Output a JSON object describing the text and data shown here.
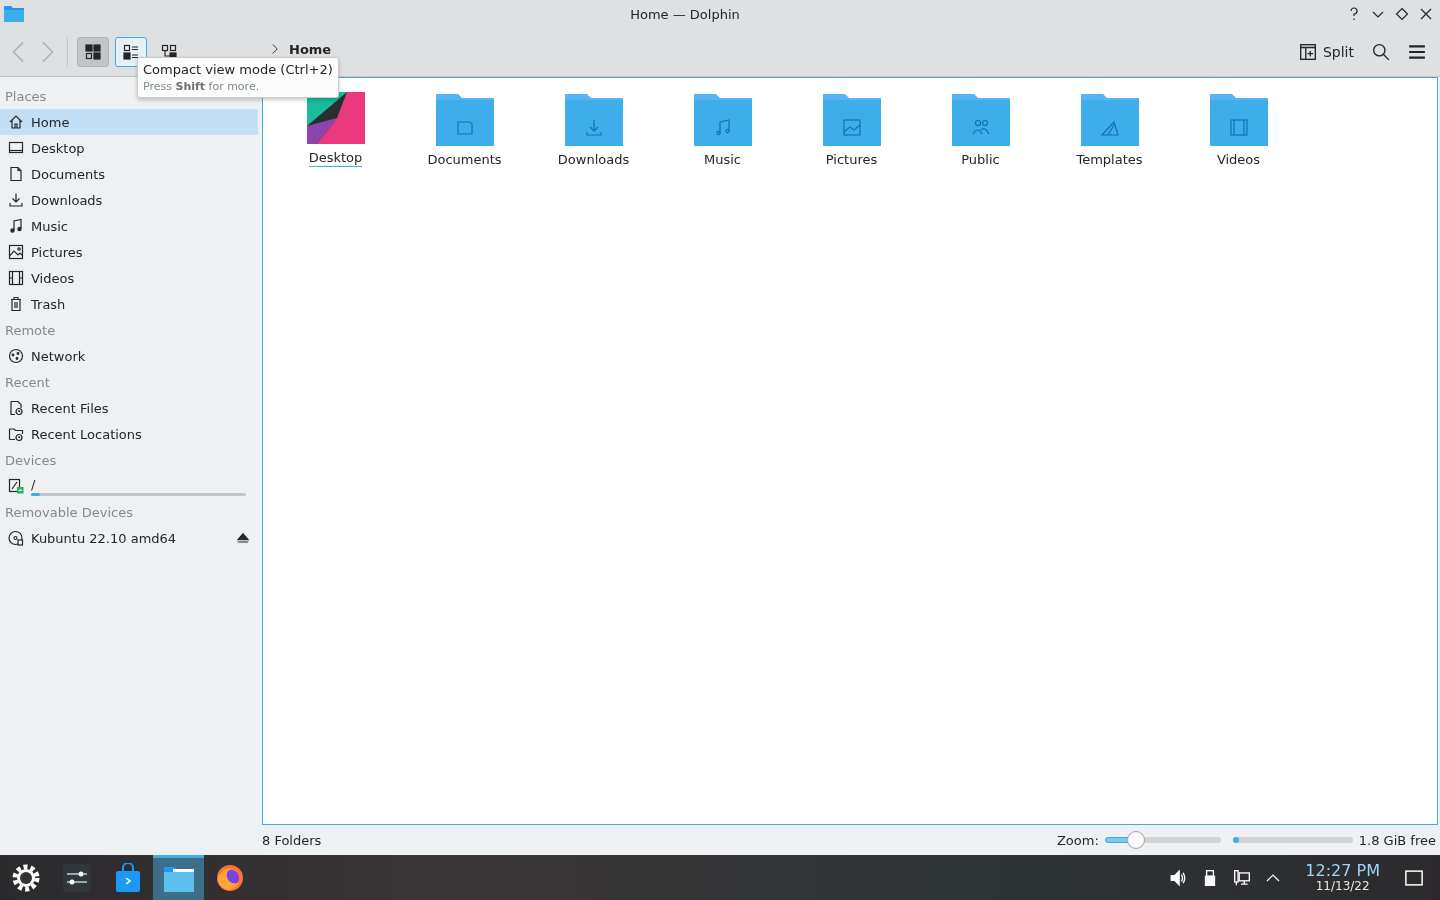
{
  "window": {
    "title": "Home — Dolphin"
  },
  "toolbar": {
    "view_modes": [
      {
        "kind": "icons",
        "selected": true,
        "hovered": false
      },
      {
        "kind": "compact",
        "selected": false,
        "hovered": true
      },
      {
        "kind": "details",
        "selected": false,
        "hovered": false
      }
    ],
    "breadcrumb": "Home",
    "split_label": "Split"
  },
  "tooltip": {
    "title": "Compact view mode (Ctrl+2)",
    "hint": "Press **Shift** for more."
  },
  "sidebar": {
    "sections": [
      {
        "title": "Places",
        "items": [
          {
            "label": "Home",
            "kind": "home",
            "selected": true
          },
          {
            "label": "Desktop",
            "kind": "desktop",
            "selected": false
          },
          {
            "label": "Documents",
            "kind": "document",
            "selected": false
          },
          {
            "label": "Downloads",
            "kind": "download",
            "selected": false
          },
          {
            "label": "Music",
            "kind": "music",
            "selected": false
          },
          {
            "label": "Pictures",
            "kind": "picture",
            "selected": false
          },
          {
            "label": "Videos",
            "kind": "video",
            "selected": false
          },
          {
            "label": "Trash",
            "kind": "trash",
            "selected": false
          }
        ]
      },
      {
        "title": "Remote",
        "items": [
          {
            "label": "Network",
            "kind": "network",
            "selected": false
          }
        ]
      },
      {
        "title": "Recent",
        "items": [
          {
            "label": "Recent Files",
            "kind": "recent-file",
            "selected": false
          },
          {
            "label": "Recent Locations",
            "kind": "recent-folder",
            "selected": false
          }
        ]
      },
      {
        "title": "Devices",
        "items": [
          {
            "label": "/",
            "kind": "drive",
            "selected": false,
            "level": 0.04
          }
        ]
      },
      {
        "title": "Removable Devices",
        "items": [
          {
            "label": "Kubuntu 22.10 amd64",
            "kind": "disc",
            "selected": false,
            "ejectable": true
          }
        ]
      }
    ]
  },
  "folders": [
    {
      "label": "Desktop",
      "kind": "desktop",
      "focused": true
    },
    {
      "label": "Documents",
      "kind": "document",
      "focused": false
    },
    {
      "label": "Downloads",
      "kind": "download",
      "focused": false
    },
    {
      "label": "Music",
      "kind": "music",
      "focused": false
    },
    {
      "label": "Pictures",
      "kind": "picture",
      "focused": false
    },
    {
      "label": "Public",
      "kind": "people",
      "focused": false
    },
    {
      "label": "Templates",
      "kind": "template",
      "focused": false
    },
    {
      "label": "Videos",
      "kind": "video",
      "focused": false
    }
  ],
  "status_bar": {
    "summary": "8 Folders",
    "zoom_label": "Zoom:",
    "zoom": {
      "level": 0.27
    },
    "disk": {
      "level": 0.03
    },
    "free_space": "1.8 GiB free"
  },
  "taskbar": {
    "apps": [
      {
        "kind": "launcher",
        "selected": false
      },
      {
        "kind": "settings",
        "selected": false
      },
      {
        "kind": "store",
        "selected": false
      },
      {
        "kind": "files",
        "selected": true
      },
      {
        "kind": "browser",
        "selected": false
      }
    ],
    "time": "12:27 PM",
    "date": "11/13/22"
  }
}
